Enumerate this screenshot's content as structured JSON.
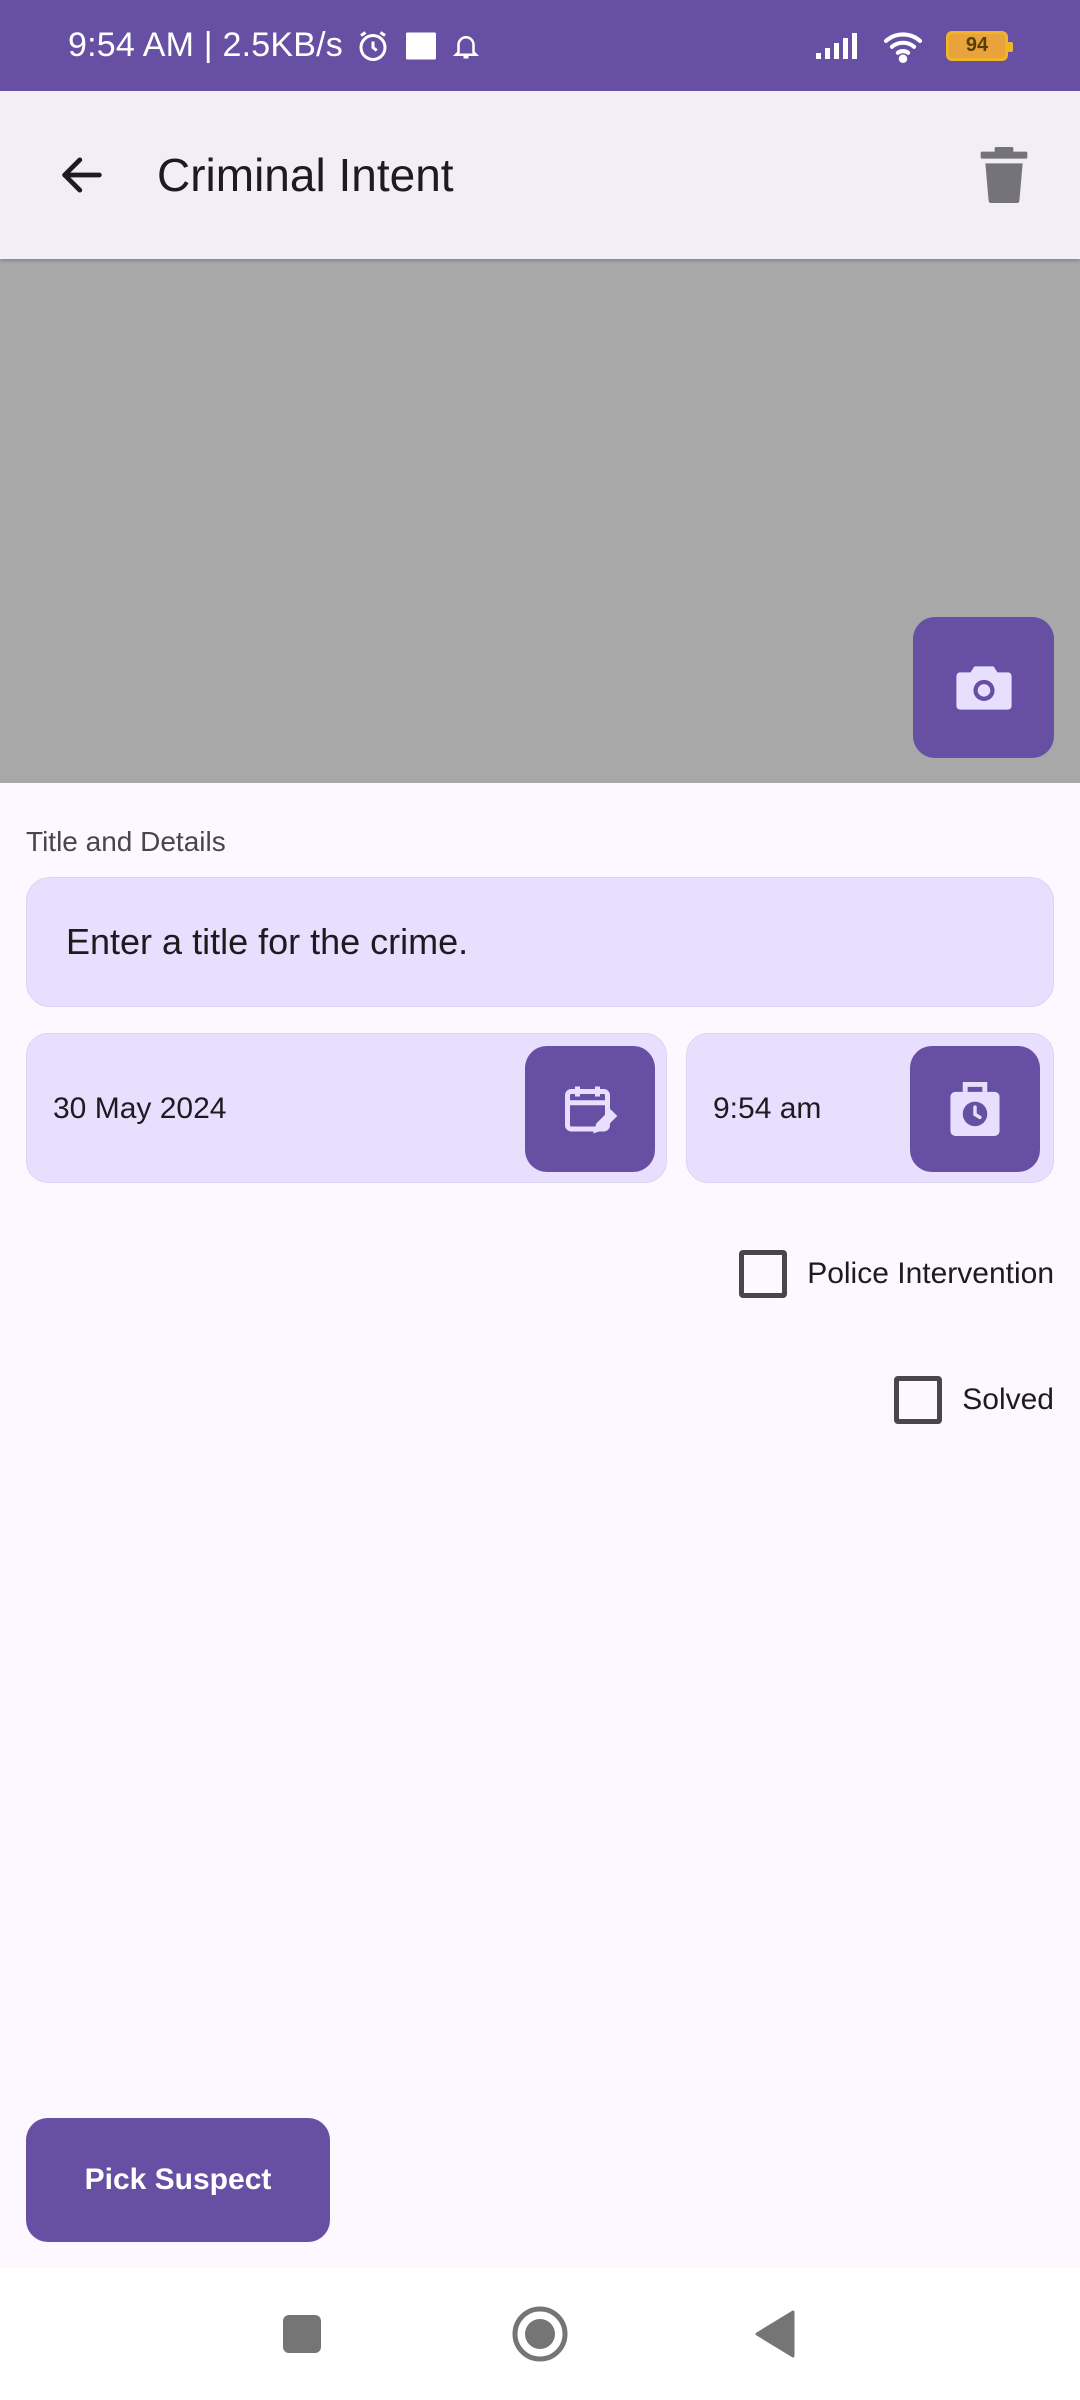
{
  "status_bar": {
    "time_speed": "9:54 AM | 2.5KB/s",
    "battery": "94",
    "icons": [
      "alarm-icon",
      "image-notification-icon",
      "bell-icon",
      "signal-icon",
      "wifi-icon",
      "battery-icon"
    ]
  },
  "app_bar": {
    "title": "Criminal Intent",
    "back_icon": "arrow-back-icon",
    "delete_icon": "trash-icon"
  },
  "photo": {
    "camera_icon": "camera-icon"
  },
  "form": {
    "section_label": "Title and Details",
    "title_placeholder": "Enter a title for the crime.",
    "date_value": "30 May 2024",
    "date_icon": "calendar-edit-icon",
    "time_value": "9:54 am",
    "time_icon": "clock-icon",
    "police_label": "Police Intervention",
    "police_checked": false,
    "solved_label": "Solved",
    "solved_checked": false
  },
  "actions": {
    "pick_suspect": "Pick Suspect"
  },
  "nav_bar": {
    "icons": [
      "recents-icon",
      "home-icon",
      "back-icon"
    ]
  },
  "colors": {
    "primary": "#6750a4",
    "field_bg": "#e8defd",
    "surface": "#fdf7ff",
    "app_bar": "#f3edf7",
    "photo_placeholder": "#a8a8a8"
  }
}
